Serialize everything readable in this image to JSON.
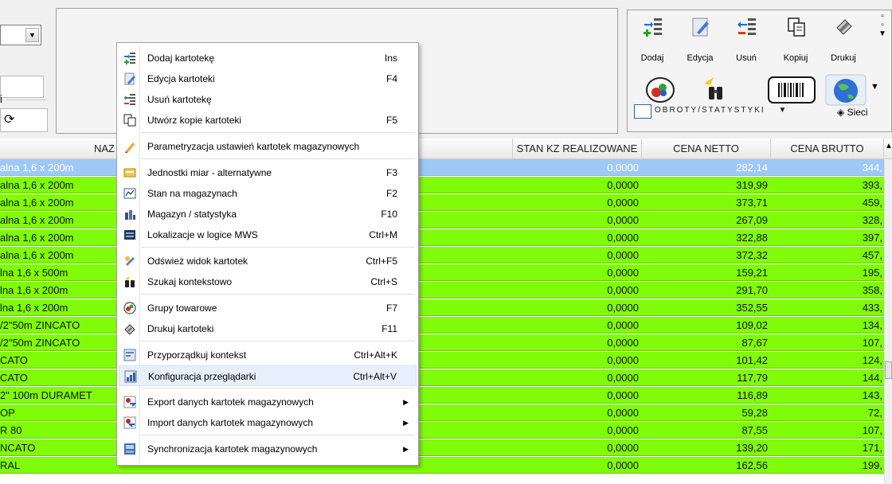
{
  "left_panel": {
    "refresh_glyph": "⟳",
    "field_label": "i"
  },
  "toolbar": {
    "buttons": [
      {
        "label": "Dodaj",
        "icon": "add-record-icon"
      },
      {
        "label": "Edycja",
        "icon": "edit-icon"
      },
      {
        "label": "Usuń",
        "icon": "remove-record-icon"
      },
      {
        "label": "Kopiuj",
        "icon": "copy-icon"
      },
      {
        "label": "Drukuj",
        "icon": "print-icon"
      }
    ],
    "obroty_label": "OBROTY/STATYSTYKI",
    "sieci_label": "Sieci"
  },
  "grid": {
    "headers": {
      "name": "NAZ",
      "stan": "STAN KZ REALIZOWANE",
      "netto": "CENA NETTO",
      "brutto": "CENA BRUTTO"
    },
    "rows": [
      {
        "name": "alna 1,6 x 200m",
        "stan": "0,0000",
        "netto": "282,14",
        "brutto": "344,"
      },
      {
        "name": "alna 1,6 x 200m",
        "stan": "0,0000",
        "netto": "319,99",
        "brutto": "393,"
      },
      {
        "name": "alna 1,6 x 200m",
        "stan": "0,0000",
        "netto": "373,71",
        "brutto": "459,"
      },
      {
        "name": "alna 1,6 x 200m",
        "stan": "0,0000",
        "netto": "267,09",
        "brutto": "328,"
      },
      {
        "name": "alna 1,6 x 200m",
        "stan": "0,0000",
        "netto": "322,88",
        "brutto": "397,"
      },
      {
        "name": "alna 1,6 x 200m",
        "stan": "0,0000",
        "netto": "372,32",
        "brutto": "457,"
      },
      {
        "name": "lna 1,6 x 500m",
        "stan": "0,0000",
        "netto": "159,21",
        "brutto": "195,"
      },
      {
        "name": "lna 1,6 x 200m",
        "stan": "0,0000",
        "netto": "291,70",
        "brutto": "358,"
      },
      {
        "name": "lna 1,6 x 200m",
        "stan": "0,0000",
        "netto": "352,55",
        "brutto": "433,"
      },
      {
        "name": "/2\"50m ZINCATO",
        "stan": "0,0000",
        "netto": "109,02",
        "brutto": "134,"
      },
      {
        "name": "/2\"50m ZINCATO",
        "stan": "0,0000",
        "netto": "87,67",
        "brutto": "107,"
      },
      {
        "name": "CATO",
        "stan": "0,0000",
        "netto": "101,42",
        "brutto": "124,"
      },
      {
        "name": "CATO",
        "stan": "0,0000",
        "netto": "117,79",
        "brutto": "144,"
      },
      {
        "name": "2\" 100m DURAMET",
        "stan": "0,0000",
        "netto": "116,89",
        "brutto": "143,"
      },
      {
        "name": "OP",
        "stan": "0,0000",
        "netto": "59,28",
        "brutto": "72,"
      },
      {
        "name": "R 80",
        "stan": "0,0000",
        "netto": "87,55",
        "brutto": "107,"
      },
      {
        "name": "NCATO",
        "stan": "0,0000",
        "netto": "139,20",
        "brutto": "171,"
      },
      {
        "name": "RAL",
        "stan": "0,0000",
        "netto": "162,56",
        "brutto": "199,"
      }
    ]
  },
  "menu": {
    "items": [
      {
        "label": "Dodaj kartotekę",
        "shortcut": "Ins",
        "icon": "add-record-icon"
      },
      {
        "label": "Edycja kartoteki",
        "shortcut": "F4",
        "icon": "edit-icon"
      },
      {
        "label": "Usuń kartotekę",
        "shortcut": "",
        "icon": "remove-record-icon"
      },
      {
        "label": "Utwórz kopie kartoteki",
        "shortcut": "F5",
        "icon": "copy-icon"
      },
      {
        "label": "Parametryzacja ustawień kartotek  magazynowych",
        "shortcut": "",
        "icon": "pencil-icon"
      },
      {
        "label": "Jednostki miar - alternatywne",
        "shortcut": "F3",
        "icon": "units-icon"
      },
      {
        "label": "Stan na magazynach",
        "shortcut": "F2",
        "icon": "stock-icon"
      },
      {
        "label": "Magazyn / statystyka",
        "shortcut": "F10",
        "icon": "warehouse-stats-icon"
      },
      {
        "label": "Lokalizacje w logice MWS",
        "shortcut": "Ctrl+M",
        "icon": "location-icon"
      },
      {
        "label": "Odśwież widok kartotek",
        "shortcut": "Ctrl+F5",
        "icon": "refresh-icon"
      },
      {
        "label": "Szukaj kontekstowo",
        "shortcut": "Ctrl+S",
        "icon": "binoculars-icon"
      },
      {
        "label": "Grupy towarowe",
        "shortcut": "F7",
        "icon": "groups-icon"
      },
      {
        "label": "Drukuj kartoteki",
        "shortcut": "F11",
        "icon": "print-icon"
      },
      {
        "label": "Przyporządkuj kontekst",
        "shortcut": "Ctrl+Alt+K",
        "icon": "context-icon"
      },
      {
        "label": "Konfiguracja przeglądarki",
        "shortcut": "Ctrl+Alt+V",
        "icon": "browser-config-icon"
      },
      {
        "label": "Export danych kartotek magazynowych",
        "shortcut": "",
        "icon": "export-icon"
      },
      {
        "label": "Import danych kartotek magazynowych",
        "shortcut": "",
        "icon": "import-icon"
      },
      {
        "label": "Synchronizacja kartotek magazynowych",
        "shortcut": "",
        "icon": "sync-icon"
      }
    ]
  },
  "colors": {
    "row_green": "#80fc0a",
    "row_selected": "#9ec9f6",
    "menu_highlight": "#e6effb"
  }
}
